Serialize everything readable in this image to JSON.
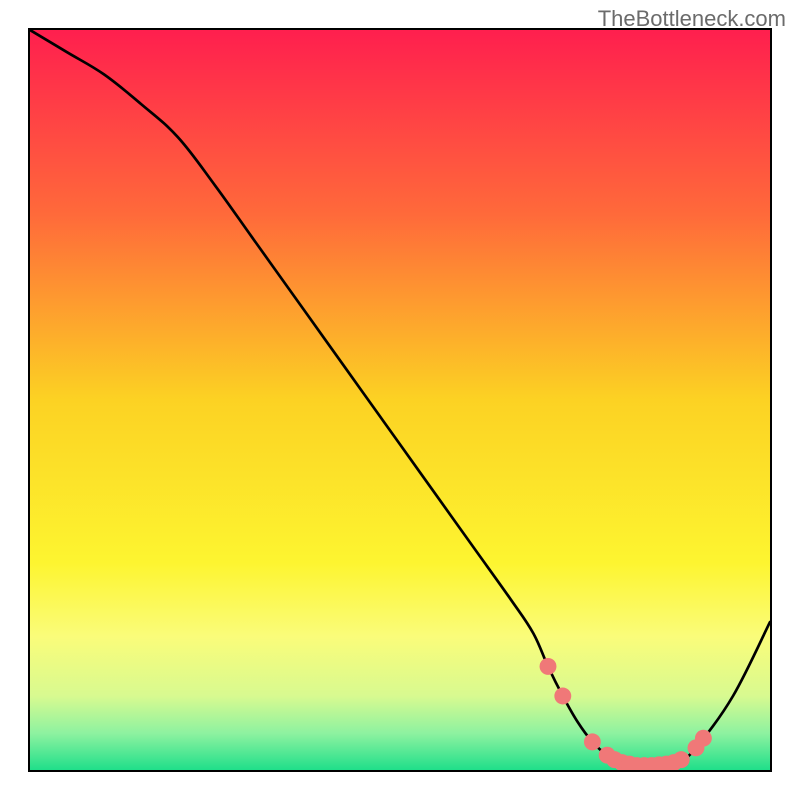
{
  "watermark": "TheBottleneck.com",
  "chart_data": {
    "type": "line",
    "title": "",
    "xlabel": "",
    "ylabel": "",
    "xlim": [
      0,
      100
    ],
    "ylim": [
      0,
      100
    ],
    "series": [
      {
        "name": "curve",
        "x": [
          0,
          5,
          10,
          15,
          20,
          25,
          30,
          35,
          40,
          45,
          50,
          55,
          60,
          65,
          68,
          70,
          72,
          74,
          76,
          78,
          80,
          82,
          84,
          86,
          88,
          90,
          95,
          100
        ],
        "y": [
          100,
          97,
          94,
          90,
          85.5,
          79,
          72,
          65,
          58,
          51,
          44,
          37,
          30,
          23,
          18.5,
          14,
          10,
          6.5,
          3.8,
          2.0,
          1.0,
          0.6,
          0.6,
          0.8,
          1.4,
          3.0,
          10,
          20
        ]
      }
    ],
    "markers": {
      "name": "highlight-points",
      "color": "#f07878",
      "x": [
        70,
        72,
        76,
        78,
        79,
        80,
        81,
        82,
        83,
        84,
        85,
        86,
        87,
        88,
        90,
        91
      ],
      "y": [
        14,
        10,
        3.8,
        2.0,
        1.4,
        1.0,
        0.8,
        0.6,
        0.6,
        0.6,
        0.7,
        0.8,
        1.0,
        1.4,
        3.0,
        4.3
      ]
    },
    "background": {
      "type": "vertical-gradient",
      "stops": [
        {
          "pos": 0.0,
          "color": "#ff1f4e"
        },
        {
          "pos": 0.25,
          "color": "#ff6a3a"
        },
        {
          "pos": 0.5,
          "color": "#fcd223"
        },
        {
          "pos": 0.72,
          "color": "#fdf530"
        },
        {
          "pos": 0.82,
          "color": "#fafc7a"
        },
        {
          "pos": 0.9,
          "color": "#d8fa90"
        },
        {
          "pos": 0.95,
          "color": "#8ef2a0"
        },
        {
          "pos": 1.0,
          "color": "#1fdf8a"
        }
      ]
    }
  }
}
